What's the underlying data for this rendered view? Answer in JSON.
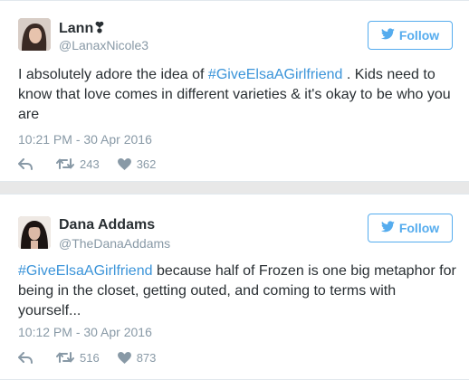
{
  "colors": {
    "link": "#3b94d9",
    "follow": "#55acee",
    "muted": "#8899a6",
    "text": "#292f33",
    "separator": "#e8e8e8"
  },
  "tweets": [
    {
      "display_name": "Lann❣",
      "handle": "@LanaxNicole3",
      "follow_label": "Follow",
      "text_before": "I absolutely adore the idea of ",
      "hashtag": "#GiveElsaAGirlfriend",
      "text_after": " . Kids need to know that love comes in different varieties & it's okay to be who you are",
      "timestamp": "10:21 PM - 30 Apr 2016",
      "retweets": "243",
      "likes": "362",
      "icons": [
        "avatar",
        "bird-icon",
        "reply-icon",
        "retweet-icon",
        "heart-icon"
      ]
    },
    {
      "display_name": "Dana Addams",
      "handle": "@TheDanaAddams",
      "follow_label": "Follow",
      "text_before": "",
      "hashtag": "#GiveElsaAGirlfriend",
      "text_after": " because half of Frozen is one big metaphor for being in the closet, getting outed, and coming to terms with yourself...",
      "timestamp": "10:12 PM - 30 Apr 2016",
      "retweets": "516",
      "likes": "873",
      "icons": [
        "avatar",
        "bird-icon",
        "reply-icon",
        "retweet-icon",
        "heart-icon"
      ]
    }
  ]
}
